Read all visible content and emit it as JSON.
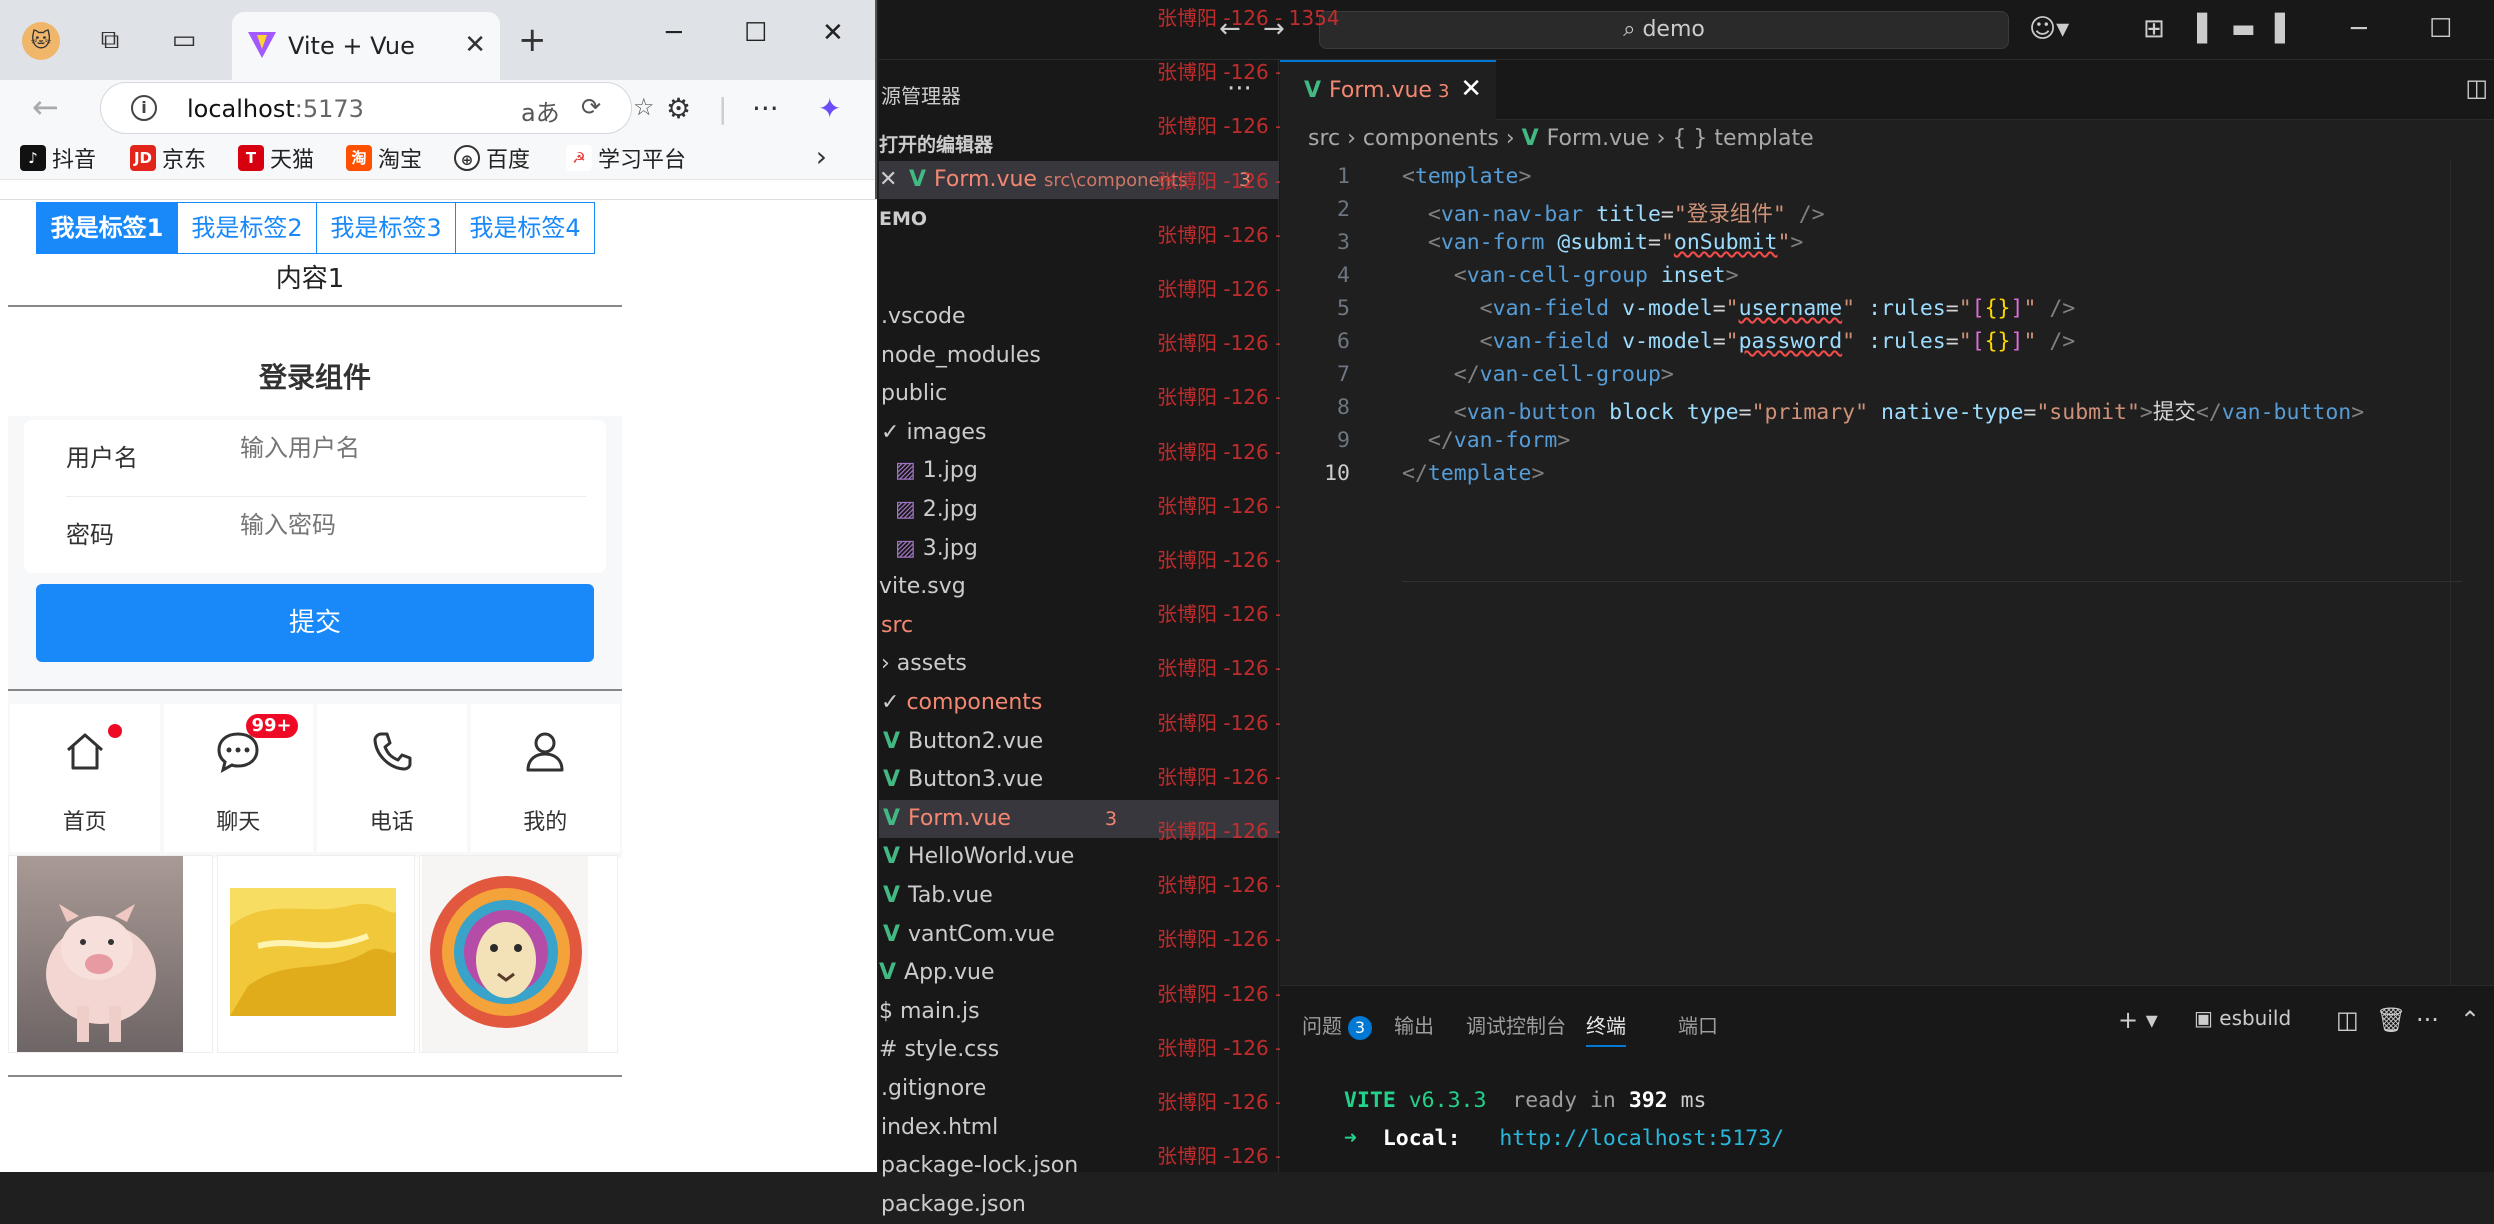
{
  "browser": {
    "tab_title": "Vite + Vue",
    "url_host": "localhost",
    "url_port": ":5173",
    "bookmarks": [
      "抖音",
      "京东",
      "天猫",
      "淘宝",
      "百度",
      "学习平台"
    ],
    "tabs": [
      "我是标签1",
      "我是标签2",
      "我是标签3",
      "我是标签4"
    ],
    "tab_content": "内容1",
    "nav_title": "登录组件",
    "fields": [
      {
        "label": "用户名",
        "placeholder": "输入用户名"
      },
      {
        "label": "密码",
        "placeholder": "输入密码"
      }
    ],
    "submit_label": "提交",
    "grid": [
      {
        "label": "首页",
        "icon": "home-icon"
      },
      {
        "label": "聊天",
        "icon": "chat-icon",
        "badge": "99+"
      },
      {
        "label": "电话",
        "icon": "phone-icon"
      },
      {
        "label": "我的",
        "icon": "user-icon"
      }
    ]
  },
  "vscode": {
    "search": "demo",
    "explorer_title": "源管理器",
    "open_editors_header": "打开的编辑器",
    "open_editor": {
      "name": "Form.vue",
      "path": "src\\components",
      "count": "3"
    },
    "project_header": "EMO",
    "tree": [
      {
        "name": ".vscode"
      },
      {
        "name": "node_modules"
      },
      {
        "name": "public"
      },
      {
        "name": "images"
      },
      {
        "name": "1.jpg"
      },
      {
        "name": "2.jpg"
      },
      {
        "name": "3.jpg"
      },
      {
        "name": "vite.svg"
      },
      {
        "name": "src"
      },
      {
        "name": "assets"
      },
      {
        "name": "components"
      },
      {
        "name": "Button2.vue"
      },
      {
        "name": "Button3.vue"
      },
      {
        "name": "Form.vue",
        "count": "3"
      },
      {
        "name": "HelloWorld.vue"
      },
      {
        "name": "Tab.vue"
      },
      {
        "name": "vantCom.vue"
      },
      {
        "name": "App.vue"
      },
      {
        "name": "main.js"
      },
      {
        "name": "style.css"
      },
      {
        "name": ".gitignore"
      },
      {
        "name": "index.html"
      },
      {
        "name": "package-lock.json"
      },
      {
        "name": "package.json"
      }
    ],
    "watermark": "张博阳 -126 - 1354",
    "editor_tab": {
      "name": "Form.vue",
      "count": "3"
    },
    "breadcrumbs": {
      "a": "src",
      "b": "components",
      "c": "Form.vue",
      "d": "{ } template"
    },
    "line_numbers": [
      "1",
      "2",
      "3",
      "4",
      "5",
      "6",
      "7",
      "8",
      "9",
      "10"
    ],
    "panel_tabs": {
      "problems": "问题",
      "problems_count": "3",
      "output": "输出",
      "debug": "调试控制台",
      "terminal": "终端",
      "ports": "端口"
    },
    "terminal_name": "esbuild",
    "term": {
      "vite": "VITE",
      "version": "v6.3.3",
      "ready": "ready in",
      "ms_val": "392",
      "ms": "ms",
      "local_label": "Local:",
      "local_url": "http://localhost:5173/"
    }
  }
}
